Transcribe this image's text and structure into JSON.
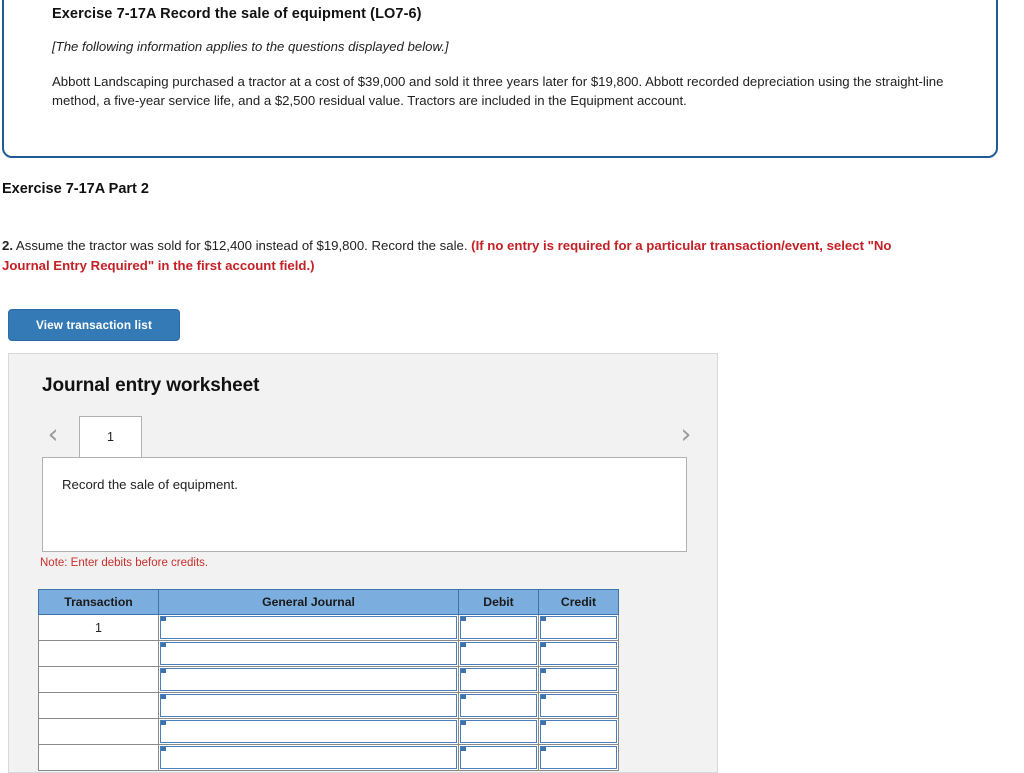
{
  "info_box": {
    "title": "Exercise 7-17A Record the sale of equipment (LO7-6)",
    "note": "[The following information applies to the questions displayed below.]",
    "body": "Abbott Landscaping purchased a tractor at a cost of $39,000 and sold it three years later for $19,800. Abbott recorded depreciation using the straight-line method, a five-year service life, and a $2,500 residual value. Tractors are included in the Equipment account."
  },
  "part_heading": "Exercise 7-17A Part 2",
  "question": {
    "number": "2.",
    "text": " Assume the tractor was sold for $12,400 instead of $19,800. Record the sale. ",
    "red_text": "(If no entry is required for a particular transaction/event, select \"No Journal Entry Required\" in the first account field.)"
  },
  "buttons": {
    "view_transaction_list": "View transaction list"
  },
  "worksheet": {
    "title": "Journal entry worksheet",
    "tabs": [
      {
        "label": "1",
        "active": true
      }
    ],
    "nav": {
      "prev_icon": "chevron-left-icon",
      "next_icon": "chevron-right-icon"
    },
    "prompt": "Record the sale of equipment.",
    "note": "Note: Enter debits before credits.",
    "table": {
      "headers": [
        "Transaction",
        "General Journal",
        "Debit",
        "Credit"
      ],
      "rows": [
        {
          "transaction": "1",
          "general_journal": "",
          "debit": "",
          "credit": ""
        },
        {
          "transaction": "",
          "general_journal": "",
          "debit": "",
          "credit": ""
        },
        {
          "transaction": "",
          "general_journal": "",
          "debit": "",
          "credit": ""
        },
        {
          "transaction": "",
          "general_journal": "",
          "debit": "",
          "credit": ""
        },
        {
          "transaction": "",
          "general_journal": "",
          "debit": "",
          "credit": ""
        },
        {
          "transaction": "",
          "general_journal": "",
          "debit": "",
          "credit": ""
        }
      ]
    }
  },
  "colors": {
    "info_box_border": "#1f5b96",
    "button_blue": "#337ab7",
    "table_header_blue": "#7badde",
    "alert_red": "#c42026",
    "note_red": "#c9302c",
    "panel_gray": "#f2f2f2"
  }
}
